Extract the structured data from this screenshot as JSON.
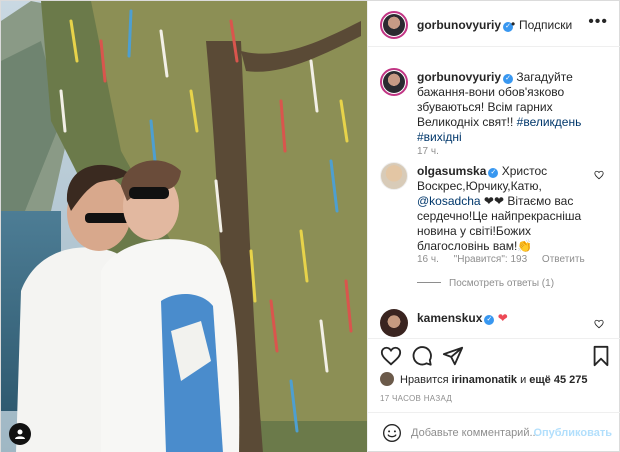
{
  "post_header": {
    "username": "gorbunovyuriy",
    "verified": true,
    "separator": "•",
    "follow_label": "Подписки",
    "more_label": "•••"
  },
  "caption": {
    "username": "gorbunovyuriy",
    "text": " Загадуйте бажання-вони обов'язково збуваються! Всім гарних Великодніх свят!! ",
    "hashtags": "#великдень #вихідні",
    "time": "17 ч."
  },
  "comments": [
    {
      "username": "olgasumska",
      "text_before": " Христос Воскрес,Юрчику,Катю, ",
      "mention": "@kosadcha",
      "text_after": " ❤❤ Вітаємо вас сердечно!Це найпрекрасніша новина у світі!Божих благословінь вам!👏",
      "time": "16 ч.",
      "likes": "\"Нравится\": 193",
      "reply_label": "Ответить",
      "view_replies": "Посмотреть ответы (1)"
    },
    {
      "username": "kamenskux",
      "text": " ❤"
    }
  ],
  "likes": {
    "prefix": "Нравится ",
    "user": "irinamonatik",
    "middle": " и ",
    "count": "ещё 45 275"
  },
  "posted_ago": "17 ЧАСОВ НАЗАД",
  "comment_box": {
    "placeholder": "Добавьте комментарий...",
    "publish_label": "Опубликовать"
  },
  "colors": {
    "accent_link": "#00376b",
    "verified": "#3897f0",
    "publish_disabled": "#b2dffc",
    "heart_red": "#ed4956",
    "story_ring": "#c13584"
  },
  "icons": [
    "heart-icon",
    "comment-icon",
    "share-icon",
    "bookmark-icon",
    "emoji-icon",
    "tag-people-icon",
    "more-options-icon"
  ]
}
